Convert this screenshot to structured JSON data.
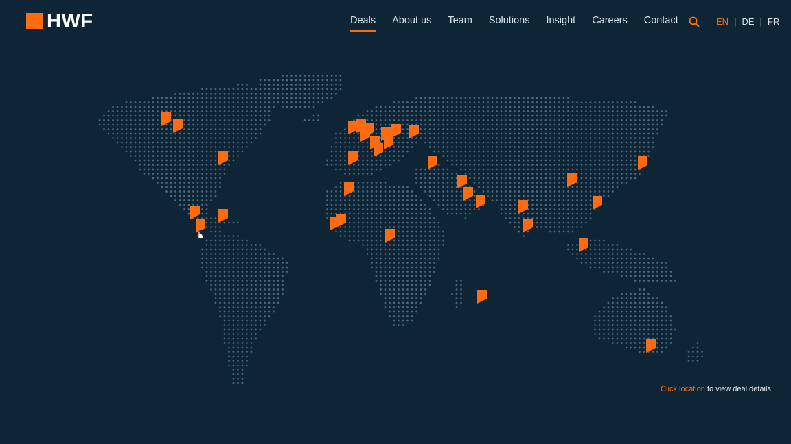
{
  "brand": {
    "name": "HWF",
    "accent": "#ff6b10",
    "background": "#0e2536",
    "dot_color": "#4d6a80"
  },
  "nav": {
    "items": [
      {
        "label": "Deals",
        "active": true
      },
      {
        "label": "About us"
      },
      {
        "label": "Team"
      },
      {
        "label": "Solutions"
      },
      {
        "label": "Insight"
      },
      {
        "label": "Careers"
      },
      {
        "label": "Contact"
      }
    ]
  },
  "search": {
    "icon": "search-icon"
  },
  "languages": {
    "items": [
      "EN",
      "DE",
      "FR"
    ],
    "current": "EN",
    "separator": "|"
  },
  "map": {
    "marker_icon": "flag-marker-icon",
    "marker_count": 38
  },
  "footnote": {
    "link": "Click location",
    "rest": " to view deal details."
  }
}
